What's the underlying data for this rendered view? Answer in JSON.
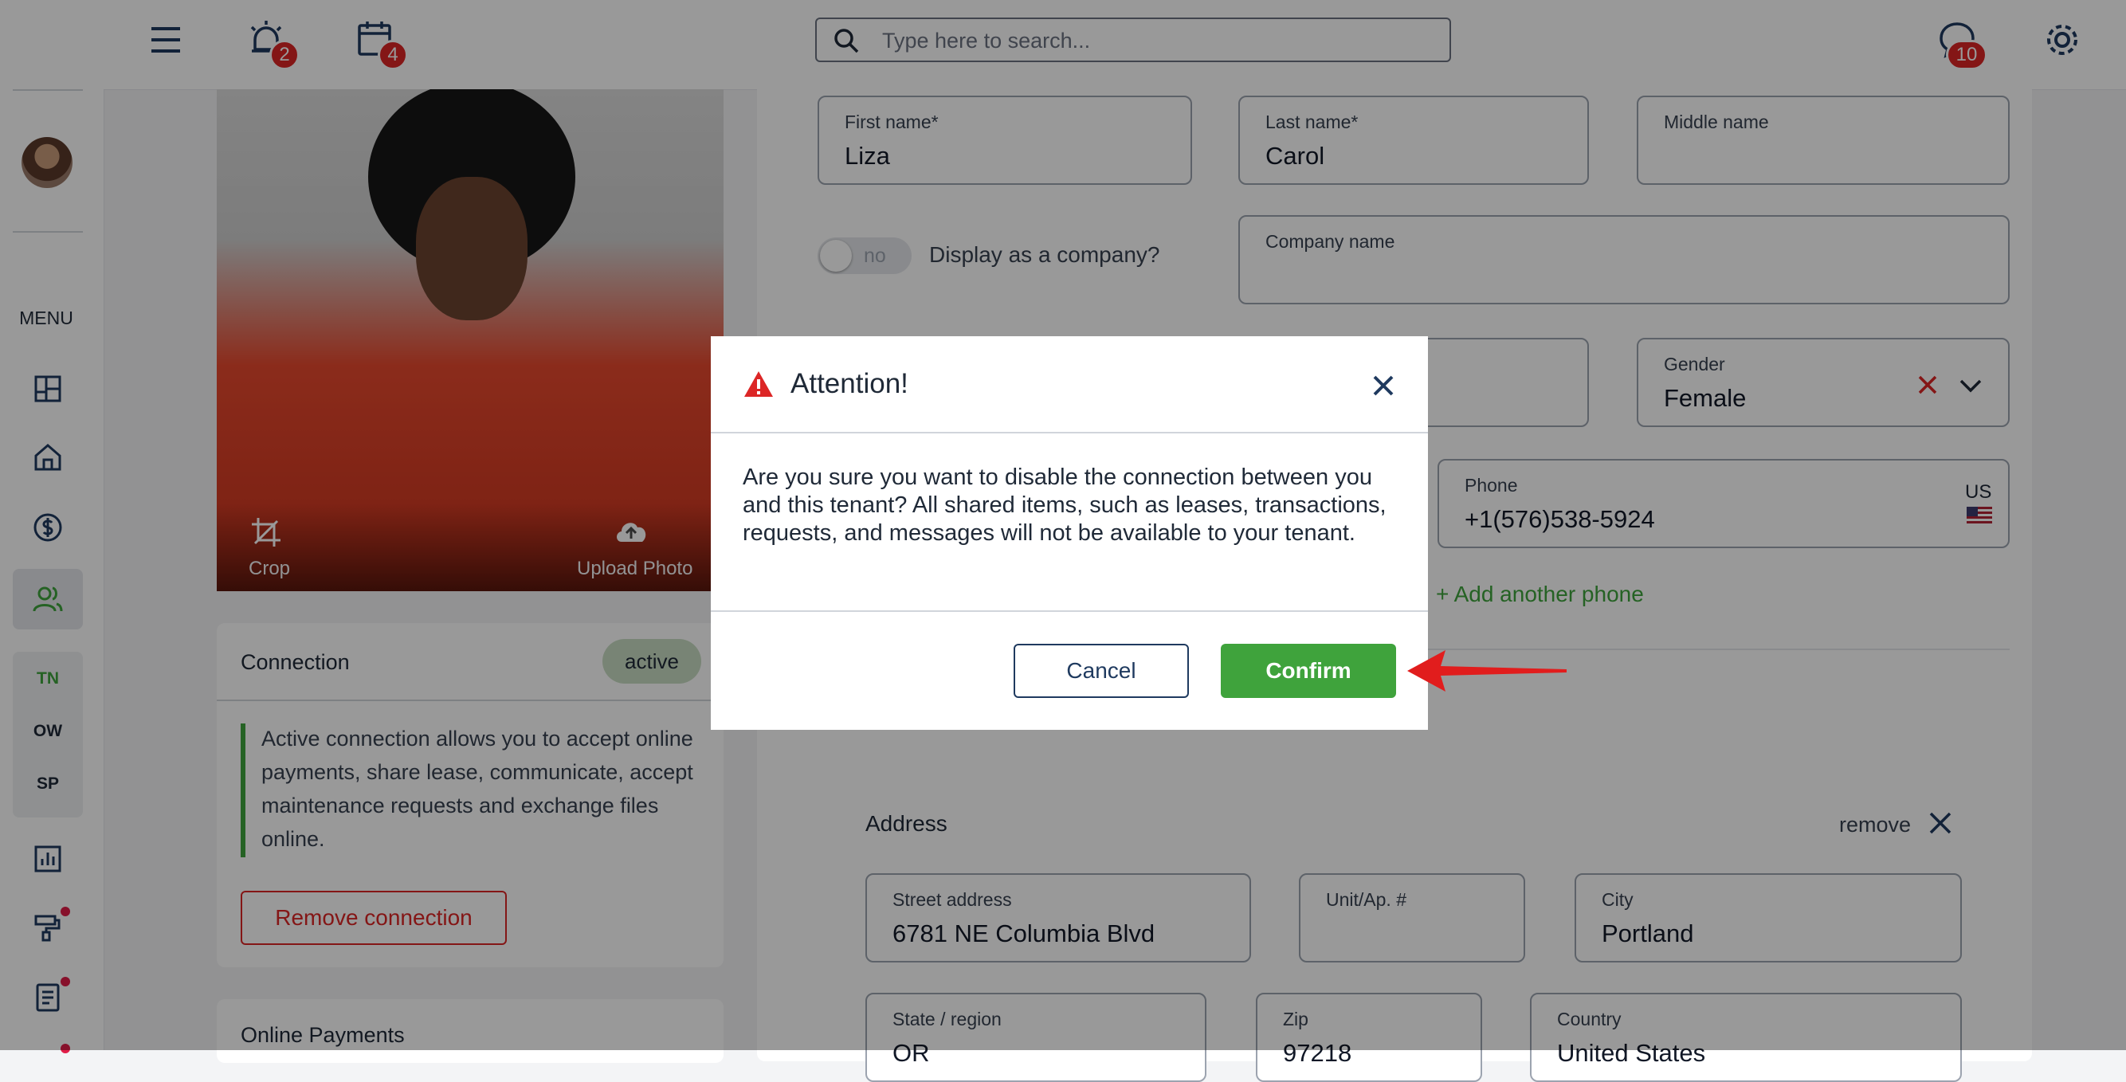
{
  "topbar": {
    "alarm_badge": "2",
    "calendar_badge": "4",
    "chat_badge": "10",
    "search_placeholder": "Type here to search..."
  },
  "sidebar": {
    "menu_label": "MENU",
    "sub_items": [
      "TN",
      "OW",
      "SP"
    ]
  },
  "photo_panel": {
    "crop_label": "Crop",
    "upload_label": "Upload Photo"
  },
  "connection": {
    "title": "Connection",
    "status": "active",
    "description": "Active connection allows you to accept online payments, share lease, communicate, accept maintenance requests and exchange files online.",
    "remove_button": "Remove connection"
  },
  "online_payments": {
    "title": "Online Payments"
  },
  "form": {
    "first_name": {
      "label": "First name*",
      "value": "Liza"
    },
    "last_name": {
      "label": "Last name*",
      "value": "Carol"
    },
    "middle_name": {
      "label": "Middle name",
      "value": ""
    },
    "company_toggle": {
      "state": "no",
      "label": "Display as a company?"
    },
    "company_name": {
      "label": "Company name",
      "value": ""
    },
    "gender": {
      "label": "Gender",
      "value": "Female"
    },
    "phone": {
      "label": "Phone",
      "value": "+1(576)538-5924",
      "country": "US"
    },
    "add_phone": "+ Add another phone",
    "address": {
      "title": "Address",
      "remove_label": "remove",
      "street": {
        "label": "Street address",
        "value": "6781 NE Columbia Blvd"
      },
      "unit": {
        "label": "Unit/Ap. #",
        "value": ""
      },
      "city": {
        "label": "City",
        "value": "Portland"
      },
      "state": {
        "label": "State / region",
        "value": "OR"
      },
      "zip": {
        "label": "Zip",
        "value": "97218"
      },
      "country": {
        "label": "Country",
        "value": "United States"
      }
    }
  },
  "modal": {
    "title": "Attention!",
    "body": "Are you sure you want to disable the connection between you and this tenant? All shared items, such as leases, transactions, requests, and messages will not be available to your tenant.",
    "cancel": "Cancel",
    "confirm": "Confirm"
  },
  "colors": {
    "accent_green": "#3fa33c",
    "danger_red": "#dc2626",
    "annotation_arrow": "#e11d1d"
  }
}
